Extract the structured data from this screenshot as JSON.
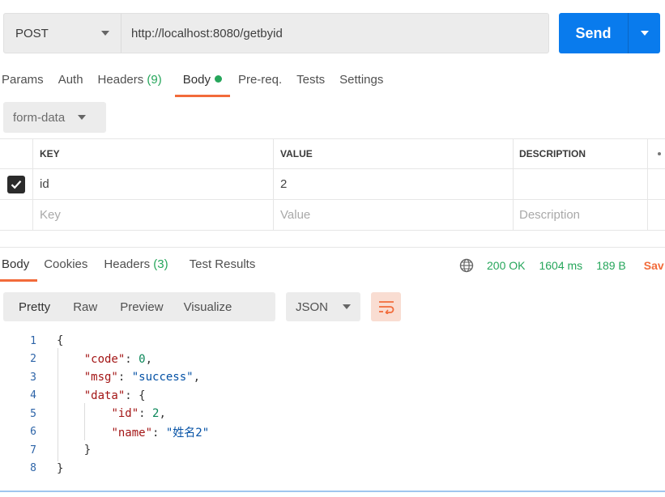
{
  "request": {
    "method": "POST",
    "url": "http://localhost:8080/getbyid",
    "send_label": "Send"
  },
  "request_tabs": [
    {
      "label": "Params"
    },
    {
      "label": "Auth"
    },
    {
      "label": "Headers",
      "count": "(9)"
    },
    {
      "label": "Body",
      "active": true
    },
    {
      "label": "Pre-req."
    },
    {
      "label": "Tests"
    },
    {
      "label": "Settings"
    }
  ],
  "body_type": "form-data",
  "kv_table": {
    "headers": [
      "KEY",
      "VALUE",
      "DESCRIPTION"
    ],
    "rows": [
      {
        "checked": true,
        "key": "id",
        "value": "2",
        "description": ""
      }
    ],
    "placeholders": {
      "key": "Key",
      "value": "Value",
      "description": "Description"
    }
  },
  "response_tabs": [
    {
      "label": "Body",
      "active": true
    },
    {
      "label": "Cookies"
    },
    {
      "label": "Headers",
      "count": "(3)"
    },
    {
      "label": "Test Results"
    }
  ],
  "response_status": {
    "status": "200 OK",
    "time": "1604 ms",
    "size": "189 B",
    "save_label": "Sav"
  },
  "view_modes": [
    "Pretty",
    "Raw",
    "Preview",
    "Visualize"
  ],
  "format": "JSON",
  "code_lines": [
    {
      "n": "1",
      "text": "{"
    },
    {
      "n": "2",
      "text": "    \"code\": 0,"
    },
    {
      "n": "3",
      "text": "    \"msg\": \"success\","
    },
    {
      "n": "4",
      "text": "    \"data\": {"
    },
    {
      "n": "5",
      "text": "        \"id\": 2,"
    },
    {
      "n": "6",
      "text": "        \"name\": \"姓名2\""
    },
    {
      "n": "7",
      "text": "    }"
    },
    {
      "n": "8",
      "text": "}"
    }
  ],
  "colors": {
    "accent": "#f26b3a",
    "send": "#097bed",
    "success": "#26a65b"
  }
}
